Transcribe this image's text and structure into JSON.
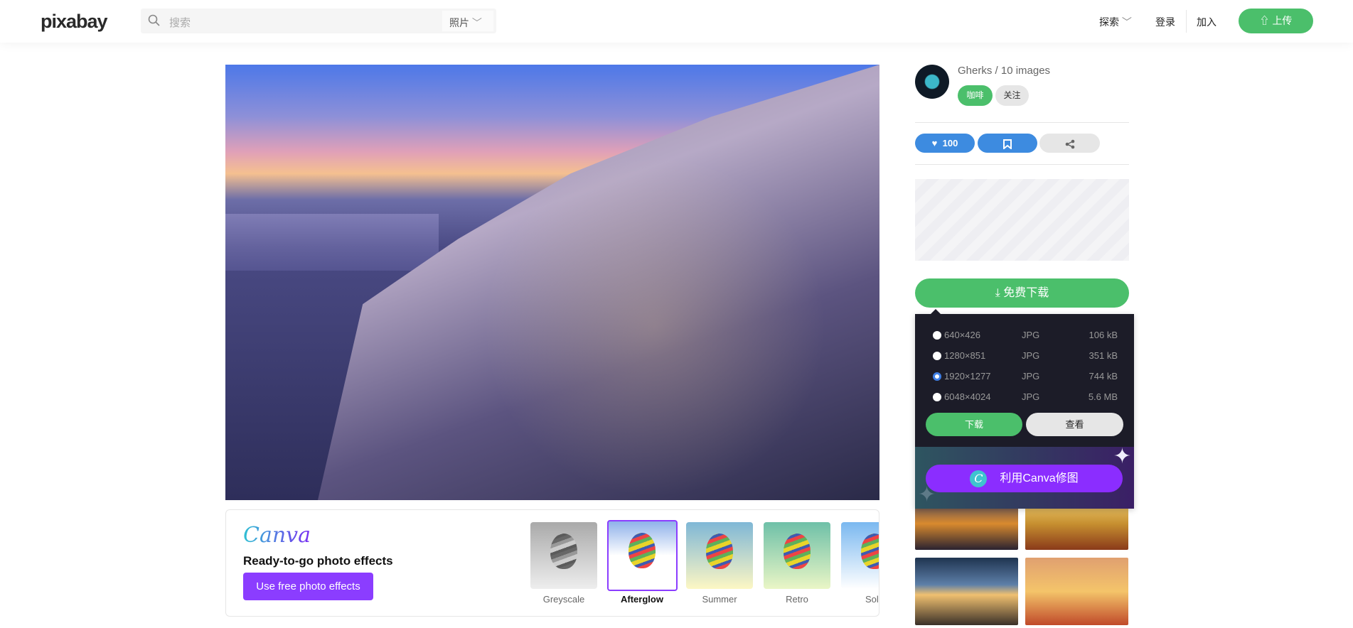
{
  "header": {
    "logo": "pixabay",
    "search_placeholder": "搜索",
    "search_type": "照片",
    "explore": "探索",
    "login": "登录",
    "join": "加入",
    "upload": "上传"
  },
  "author": {
    "name": "Gherks / 10 images",
    "coffee": "咖啡",
    "follow": "关注"
  },
  "actions": {
    "likes": "100"
  },
  "download": {
    "label": "免费下载",
    "options": [
      {
        "resolution": "640×426",
        "format": "JPG",
        "size": "106 kB",
        "selected": false
      },
      {
        "resolution": "1280×851",
        "format": "JPG",
        "size": "351 kB",
        "selected": false
      },
      {
        "resolution": "1920×1277",
        "format": "JPG",
        "size": "744 kB",
        "selected": true
      },
      {
        "resolution": "6048×4024",
        "format": "JPG",
        "size": "5.6 MB",
        "selected": false
      }
    ],
    "download_btn": "下载",
    "view_btn": "查看",
    "canva_btn": "利用Canva修图"
  },
  "canva": {
    "logo": "Canva",
    "headline": "Ready-to-go photo effects",
    "button": "Use free photo effects",
    "effects": [
      {
        "label": "Greyscale"
      },
      {
        "label": "Afterglow",
        "selected": true
      },
      {
        "label": "Summer"
      },
      {
        "label": "Retro"
      },
      {
        "label": "Sola"
      }
    ]
  },
  "colors": {
    "green": "#4bbf6b",
    "blue": "#3d8be0",
    "purple": "#8b3dff",
    "panel": "#1c1c28"
  }
}
